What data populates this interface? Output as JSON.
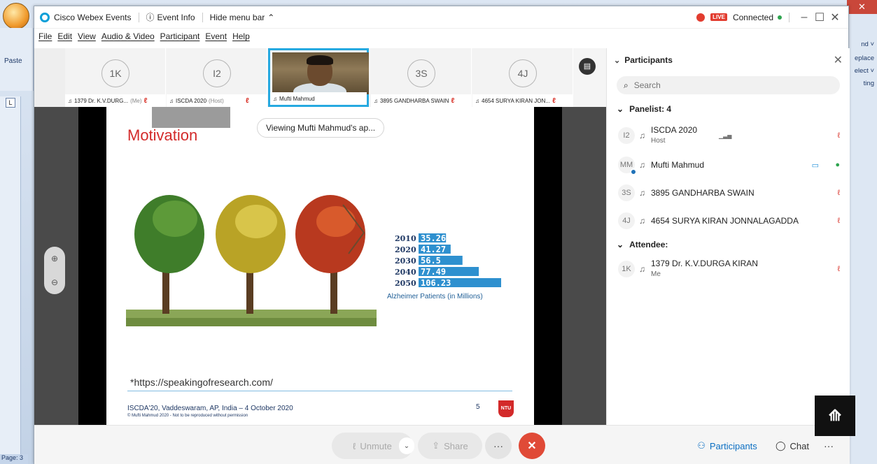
{
  "titlebar": {
    "app_name": "Cisco Webex Events",
    "event_info": "Event Info",
    "hide_menu": "Hide menu bar",
    "live": "LIVE",
    "connected": "Connected"
  },
  "menu": [
    "File",
    "Edit",
    "View",
    "Audio & Video",
    "Participant",
    "Event",
    "Help"
  ],
  "strip": {
    "tiles": [
      {
        "initials": "1K",
        "caption": "1379 Dr. K.V.DURG...",
        "suffix": "(Me)"
      },
      {
        "initials": "I2",
        "caption": "ISCDA 2020",
        "suffix": "(Host)"
      },
      {
        "initials": "",
        "caption": "Mufti Mahmud",
        "suffix": ""
      },
      {
        "initials": "3S",
        "caption": "3895 GANDHARBA SWAIN",
        "suffix": ""
      },
      {
        "initials": "4J",
        "caption": "4654 SURYA KIRAN JON...",
        "suffix": ""
      }
    ]
  },
  "stage": {
    "viewing": "Viewing Mufti Mahmud's ap..."
  },
  "slide": {
    "title": "Motivation",
    "bars": [
      {
        "year": "2010",
        "value": "35.26",
        "num": 35.26
      },
      {
        "year": "2020",
        "value": "41.27",
        "num": 41.27
      },
      {
        "year": "2030",
        "value": "56.5",
        "num": 56.5
      },
      {
        "year": "2040",
        "value": "77.49",
        "num": 77.49
      },
      {
        "year": "2050",
        "value": "106.23",
        "num": 106.23
      }
    ],
    "bars_caption": "Alzheimer Patients (in Millions)",
    "link": "*https://speakingofresearch.com/",
    "footer": "ISCDA'20, Vaddeswaram, AP, India – 4 October 2020",
    "footer_small": "© Mufti Mahmud 2020 - Not to be reproduced without permission",
    "page": "5",
    "logo": "NTU"
  },
  "controls": {
    "unmute": "Unmute",
    "share": "Share",
    "participants": "Participants",
    "chat": "Chat"
  },
  "panel": {
    "title": "Participants",
    "search_placeholder": "Search",
    "panelist_head": "Panelist: 4",
    "attendee_head": "Attendee:",
    "panelists": [
      {
        "initials": "I2",
        "name": "ISCDA 2020",
        "sub": "Host"
      },
      {
        "initials": "MM",
        "name": "Mufti Mahmud",
        "sub": ""
      },
      {
        "initials": "3S",
        "name": "3895 GANDHARBA SWAIN",
        "sub": ""
      },
      {
        "initials": "4J",
        "name": "4654 SURYA KIRAN JONNALAGADDA",
        "sub": ""
      }
    ],
    "attendees": [
      {
        "initials": "1K",
        "name": "1379 Dr. K.V.DURGA KIRAN",
        "sub": "Me"
      }
    ]
  },
  "word": {
    "paste": "Paste",
    "right_labels": [
      "nd ˅",
      "eplace",
      "elect ˅",
      "ting"
    ],
    "status": "Page: 3"
  },
  "colors": {
    "accent": "#26a9e0",
    "leave": "#e04a37",
    "bar": "#2e90cf",
    "title_red": "#d32a2a"
  }
}
